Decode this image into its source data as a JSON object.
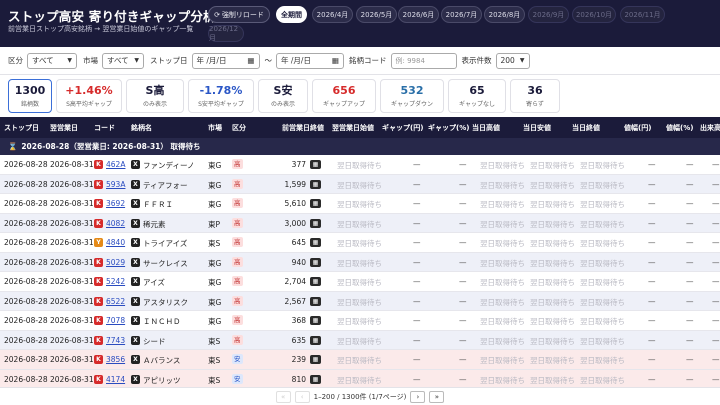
{
  "header": {
    "title": "ストップ高安 寄り付きギャップ分析",
    "subtitle": "前営業日ストップ高安銘柄 → 翌営業日始値のギャップ一覧",
    "reload_label": "強制リロード",
    "period_pills": [
      {
        "label": "全期間",
        "state": "active"
      },
      {
        "label": "2026/4月",
        "state": "normal"
      },
      {
        "label": "2026/5月",
        "state": "normal"
      },
      {
        "label": "2026/6月",
        "state": "normal"
      },
      {
        "label": "2026/7月",
        "state": "normal"
      },
      {
        "label": "2026/8月",
        "state": "normal"
      },
      {
        "label": "2026/9月",
        "state": "disabled"
      },
      {
        "label": "2026/10月",
        "state": "disabled"
      },
      {
        "label": "2026/11月",
        "state": "disabled"
      },
      {
        "label": "2026/12月",
        "state": "disabled"
      }
    ]
  },
  "filters": {
    "kubun_label": "区分",
    "kubun_value": "すべて",
    "market_label": "市場",
    "market_value": "すべて",
    "stop_date_label": "ストップ日",
    "date_from": "年 /月/日",
    "tilde": "～",
    "date_to": "年 /月/日",
    "code_label": "銘柄コード",
    "code_placeholder": "例: 9984",
    "count_label": "表示件数",
    "count_value": "200"
  },
  "stats": [
    {
      "value": "1300",
      "label": "銘柄数",
      "color": "#1b1b3a",
      "selected": true
    },
    {
      "value": "+1.46%",
      "label": "S高平均ギャップ",
      "color": "#d62b2b"
    },
    {
      "value": "S高",
      "label": "のみ表示",
      "color": "#1b1b3a"
    },
    {
      "value": "-1.78%",
      "label": "S安平均ギャップ",
      "color": "#2a56c6"
    },
    {
      "value": "S安",
      "label": "のみ表示",
      "color": "#1b1b3a"
    },
    {
      "value": "656",
      "label": "ギャップアップ",
      "color": "#d62b2b"
    },
    {
      "value": "532",
      "label": "ギャップダウン",
      "color": "#2a6fa8"
    },
    {
      "value": "65",
      "label": "ギャップなし",
      "color": "#1b1b3a"
    },
    {
      "value": "36",
      "label": "寄らず",
      "color": "#1b1b3a"
    }
  ],
  "table": {
    "columns": [
      "ストップ日",
      "翌営業日",
      "コード",
      "銘柄名",
      "市場",
      "区分",
      "前営業日終値",
      "翌営業日始値",
      "ギャップ(円)",
      "ギャップ(%)",
      "当日高値",
      "当日安値",
      "当日終値",
      "値幅(円)",
      "値幅(%)",
      "出来高"
    ],
    "group_label": "2026-08-28（翌営業日: 2026-08-31） 取得待ち",
    "pending_text": "翌日取得待ち",
    "dash": "—",
    "rows": [
      {
        "stop_date": "2026-08-28",
        "next_date": "2026-08-31",
        "code": "462A",
        "badge": "K",
        "badge_color": "red",
        "name": "ファンディーノ",
        "market": "東G",
        "kubun": "高",
        "close": "377"
      },
      {
        "stop_date": "2026-08-28",
        "next_date": "2026-08-31",
        "code": "593A",
        "badge": "K",
        "badge_color": "red",
        "name": "ティアフォー",
        "market": "東G",
        "kubun": "高",
        "close": "1,599"
      },
      {
        "stop_date": "2026-08-28",
        "next_date": "2026-08-31",
        "code": "3692",
        "badge": "K",
        "badge_color": "red",
        "name": "ＦＦＲＩ",
        "market": "東G",
        "kubun": "高",
        "close": "5,610"
      },
      {
        "stop_date": "2026-08-28",
        "next_date": "2026-08-31",
        "code": "4082",
        "badge": "K",
        "badge_color": "red",
        "name": "稀元素",
        "market": "東P",
        "kubun": "高",
        "close": "3,000"
      },
      {
        "stop_date": "2026-08-28",
        "next_date": "2026-08-31",
        "code": "4840",
        "badge": "Y",
        "badge_color": "orange",
        "name": "トライアイズ",
        "market": "東S",
        "kubun": "高",
        "close": "645"
      },
      {
        "stop_date": "2026-08-28",
        "next_date": "2026-08-31",
        "code": "5029",
        "badge": "K",
        "badge_color": "red",
        "name": "サークレイス",
        "market": "東G",
        "kubun": "高",
        "close": "940"
      },
      {
        "stop_date": "2026-08-28",
        "next_date": "2026-08-31",
        "code": "5242",
        "badge": "K",
        "badge_color": "red",
        "name": "アイズ",
        "market": "東G",
        "kubun": "高",
        "close": "2,704"
      },
      {
        "stop_date": "2026-08-28",
        "next_date": "2026-08-31",
        "code": "6522",
        "badge": "K",
        "badge_color": "red",
        "name": "アスタリスク",
        "market": "東G",
        "kubun": "高",
        "close": "2,567"
      },
      {
        "stop_date": "2026-08-28",
        "next_date": "2026-08-31",
        "code": "7078",
        "badge": "K",
        "badge_color": "red",
        "name": "ＩＮＣＨＤ",
        "market": "東G",
        "kubun": "高",
        "close": "368"
      },
      {
        "stop_date": "2026-08-28",
        "next_date": "2026-08-31",
        "code": "7743",
        "badge": "K",
        "badge_color": "red",
        "name": "シード",
        "market": "東S",
        "kubun": "高",
        "close": "635"
      },
      {
        "stop_date": "2026-08-28",
        "next_date": "2026-08-31",
        "code": "3856",
        "badge": "K",
        "badge_color": "red",
        "name": "Ａバランス",
        "market": "東S",
        "kubun": "安",
        "close": "239"
      },
      {
        "stop_date": "2026-08-28",
        "next_date": "2026-08-31",
        "code": "4174",
        "badge": "K",
        "badge_color": "red",
        "name": "アピリッツ",
        "market": "東S",
        "kubun": "安",
        "close": "810"
      }
    ]
  },
  "pager": {
    "first": "«",
    "prev": "‹",
    "info": "1–200 / 1300件 (1/7ページ)",
    "next": "›",
    "last": "»"
  }
}
